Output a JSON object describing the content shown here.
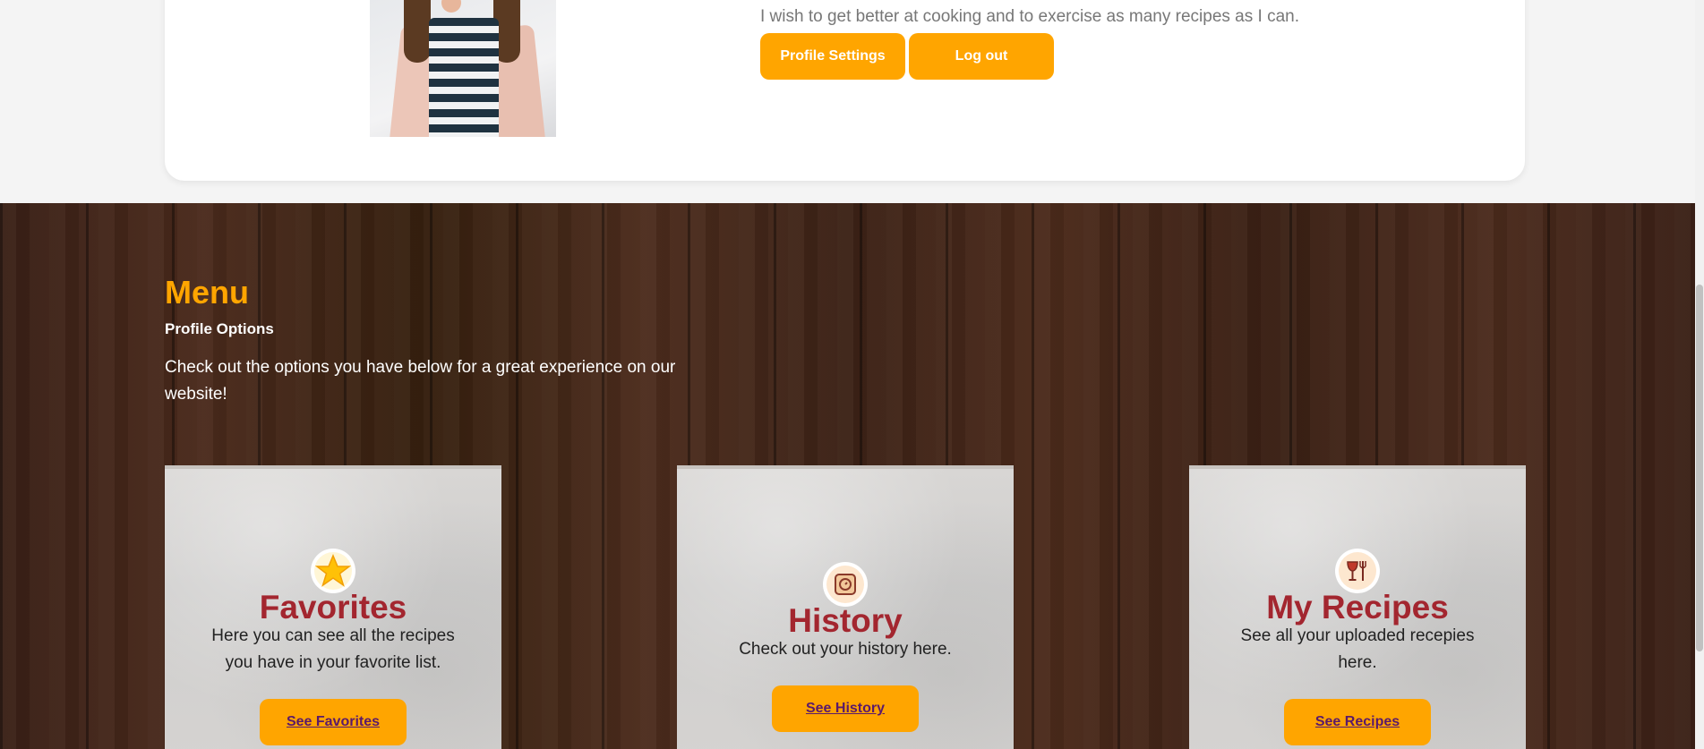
{
  "profile": {
    "bio": "I wish to get better at cooking and to exercise as many recipes as I can.",
    "settings_label": "Profile Settings",
    "logout_label": "Log out"
  },
  "menu": {
    "title": "Menu",
    "subtitle": "Profile Options",
    "description": "Check out the options you have below for a great experience on our website!"
  },
  "cards": [
    {
      "title": "Favorites",
      "text": "Here you can see all the recipes you have in your favorite list.",
      "button": "See Favorites",
      "icon": "star-icon"
    },
    {
      "title": "History",
      "text": "Check out your history here.",
      "button": "See History",
      "icon": "history-icon"
    },
    {
      "title": "My Recipes",
      "text": "See all your uploaded recepies here.",
      "button": "See Recipes",
      "icon": "wine-fork-icon"
    }
  ],
  "colors": {
    "accent": "#ffa500",
    "card_title": "#a3262f",
    "link": "#5a1a6b"
  }
}
